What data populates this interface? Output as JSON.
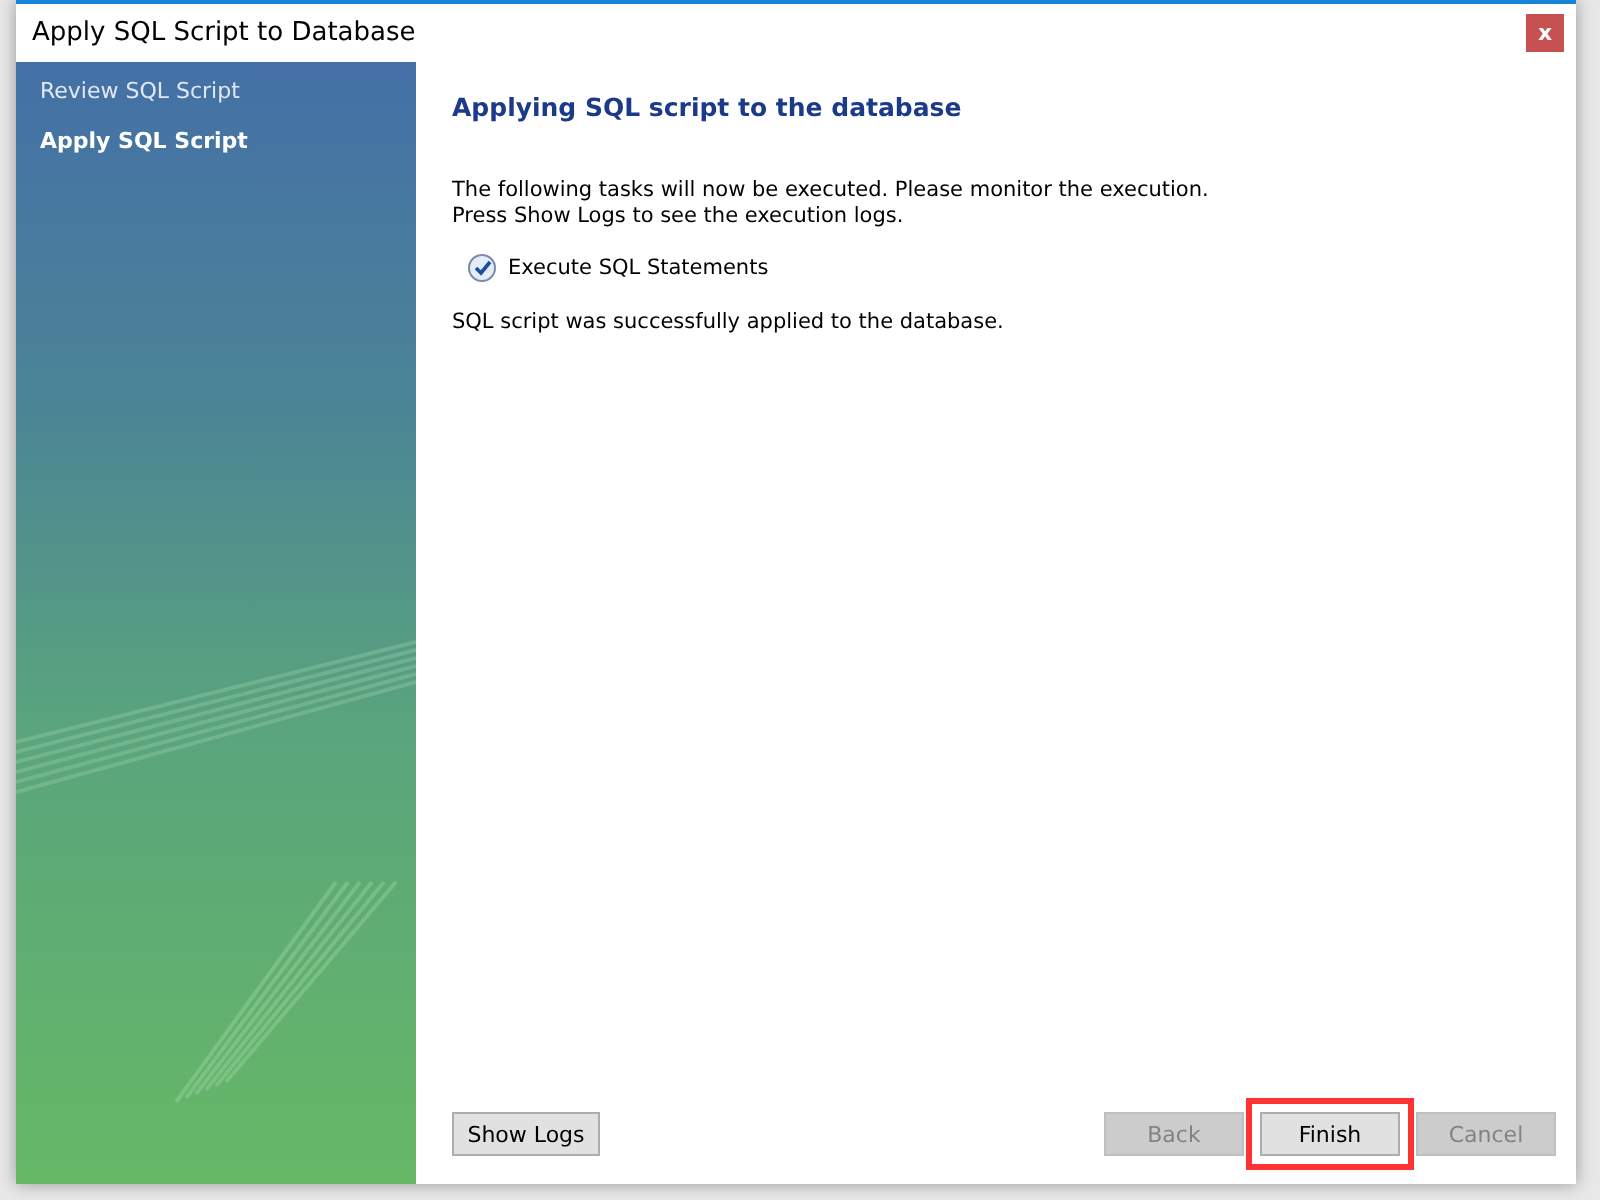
{
  "window": {
    "title": "Apply SQL Script to Database",
    "close": "x"
  },
  "steps": [
    {
      "label": "Review SQL Script",
      "selected": false
    },
    {
      "label": "Apply SQL Script",
      "selected": true
    }
  ],
  "heading": "Applying SQL script to the database",
  "intro": [
    "The following tasks will now be executed. Please monitor the execution.",
    "Press Show Logs to see the execution logs."
  ],
  "tasks": [
    {
      "label": "Execute SQL Statements",
      "checked": true
    }
  ],
  "result": "SQL script was successfully applied to the database.",
  "left_buttons": [
    {
      "label": "Show Logs",
      "disabled": false,
      "highlighted": false
    }
  ],
  "right_buttons": [
    {
      "label": "Back",
      "disabled": true,
      "highlighted": false
    },
    {
      "label": "Finish",
      "disabled": false,
      "highlighted": true
    },
    {
      "label": "Cancel",
      "disabled": true,
      "highlighted": false
    }
  ]
}
